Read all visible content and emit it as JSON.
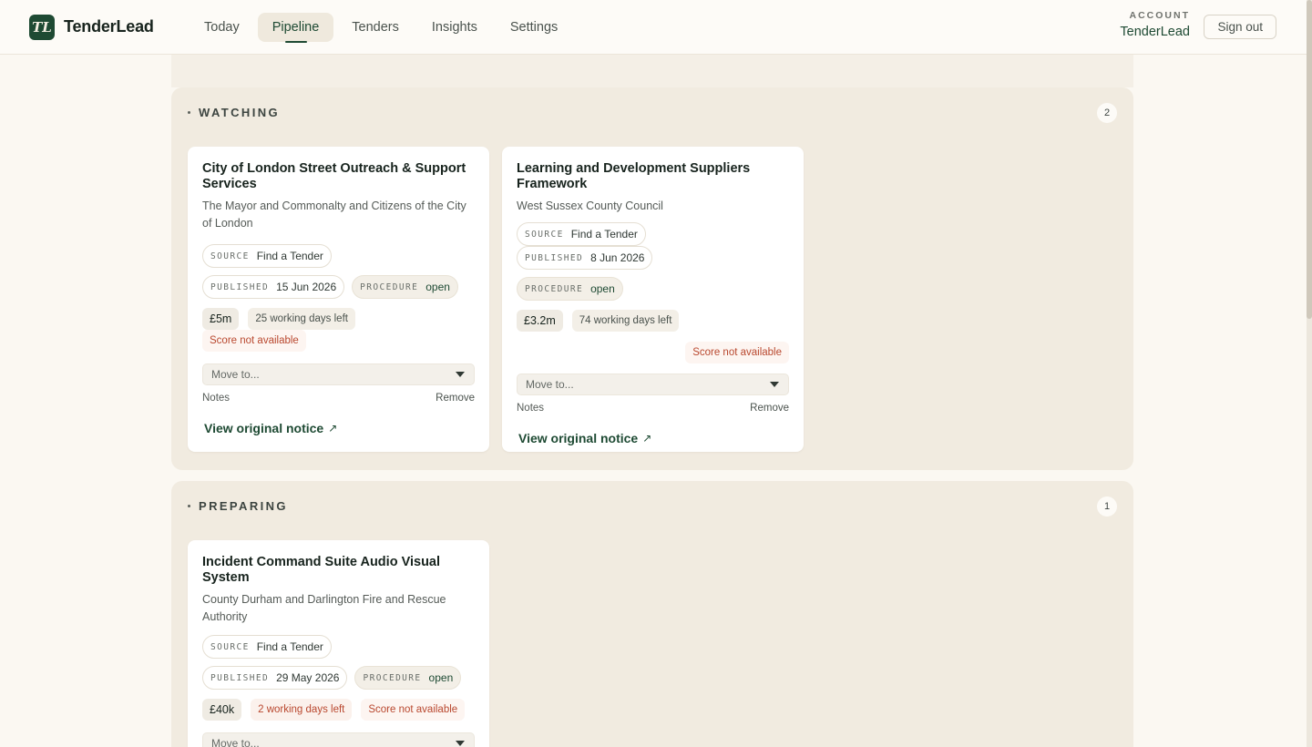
{
  "app": {
    "name": "TenderLead",
    "logo_text": "TL"
  },
  "nav": [
    {
      "label": "Today",
      "active": false
    },
    {
      "label": "Pipeline",
      "active": true
    },
    {
      "label": "Tenders",
      "active": false
    },
    {
      "label": "Insights",
      "active": false
    },
    {
      "label": "Settings",
      "active": false
    }
  ],
  "account": {
    "label": "ACCOUNT",
    "name": "TenderLead",
    "signout_label": "Sign out"
  },
  "labels": {
    "source_key": "SOURCE",
    "published_key": "PUBLISHED",
    "procedure_key": "PROCEDURE",
    "move_placeholder": "Move to...",
    "notes": "Notes",
    "remove": "Remove",
    "view_original": "View original notice",
    "score": "Score not available"
  },
  "sections": [
    {
      "title": "WATCHING",
      "count": "2",
      "cards": [
        {
          "title": "City of London Street Outreach & Support Services",
          "buyer": "The Mayor and Commonalty and Citizens of the City of London",
          "source": "Find a Tender",
          "published": "15 Jun 2026",
          "procedure": "open",
          "value": "£5m",
          "days_left": "25 working days left",
          "urgent": false
        },
        {
          "title": "Learning and Development Suppliers Framework",
          "buyer": "West Sussex County Council",
          "source": "Find a Tender",
          "published": "8 Jun 2026",
          "procedure": "open",
          "value": "£3.2m",
          "days_left": "74 working days left",
          "urgent": false
        }
      ]
    },
    {
      "title": "PREPARING",
      "count": "1",
      "cards": [
        {
          "title": "Incident Command Suite Audio Visual System",
          "buyer": "County Durham and Darlington Fire and Rescue Authority",
          "source": "Find a Tender",
          "published": "29 May 2026",
          "procedure": "open",
          "value": "£40k",
          "days_left": "2 working days left",
          "urgent": true
        }
      ]
    }
  ],
  "colors": {
    "brand": "#1e4a33",
    "background": "#fbf8f2",
    "section": "#f1ebe0",
    "warning": "#b9482f"
  },
  "icons": {
    "external_link": "north-east-arrow-icon",
    "dropdown": "caret-down-icon"
  }
}
